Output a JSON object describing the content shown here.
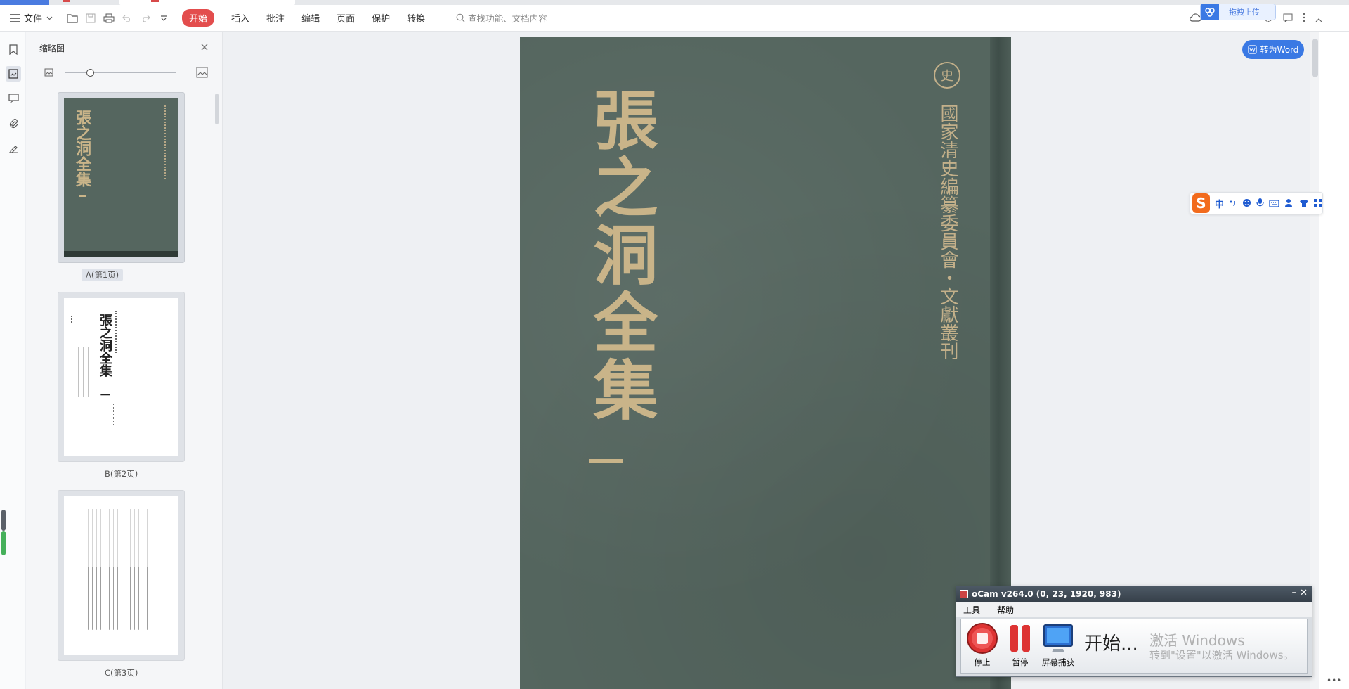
{
  "toolbar": {
    "file_label": "文件",
    "menu": [
      "开始",
      "插入",
      "批注",
      "编辑",
      "页面",
      "保护",
      "转换"
    ],
    "search_placeholder": "查找功能、文档内容"
  },
  "upload_popup": {
    "label": "拖拽上传"
  },
  "thumbnail_panel": {
    "title": "缩略图",
    "thumbs": [
      {
        "label": "A(第1页)"
      },
      {
        "label": "B(第2页)"
      },
      {
        "label": "C(第3页)"
      }
    ],
    "thumb2_text": {
      "title": "張之洞全集",
      "vol": "一"
    }
  },
  "document": {
    "cover_title": "張之洞全集",
    "cover_series": "國家清史編纂委員會・文獻叢刊",
    "cover_seal": "史"
  },
  "to_word": {
    "label": "转为Word"
  },
  "ime": {
    "logo": "S",
    "lang": "中"
  },
  "ocam": {
    "title": "oCam v264.0 (0, 23, 1920, 983)",
    "menu": [
      "工具",
      "帮助"
    ],
    "buttons": [
      "停止",
      "暂停",
      "屏幕捕获"
    ],
    "status": "开始..."
  },
  "watermark": {
    "line1": "激活 Windows",
    "line2": "转到\"设置\"以激活 Windows。"
  },
  "colors": {
    "accent": "#3a79e4",
    "start": "#e34d4d",
    "cover": "#55665f",
    "gold": "#c9b489"
  }
}
